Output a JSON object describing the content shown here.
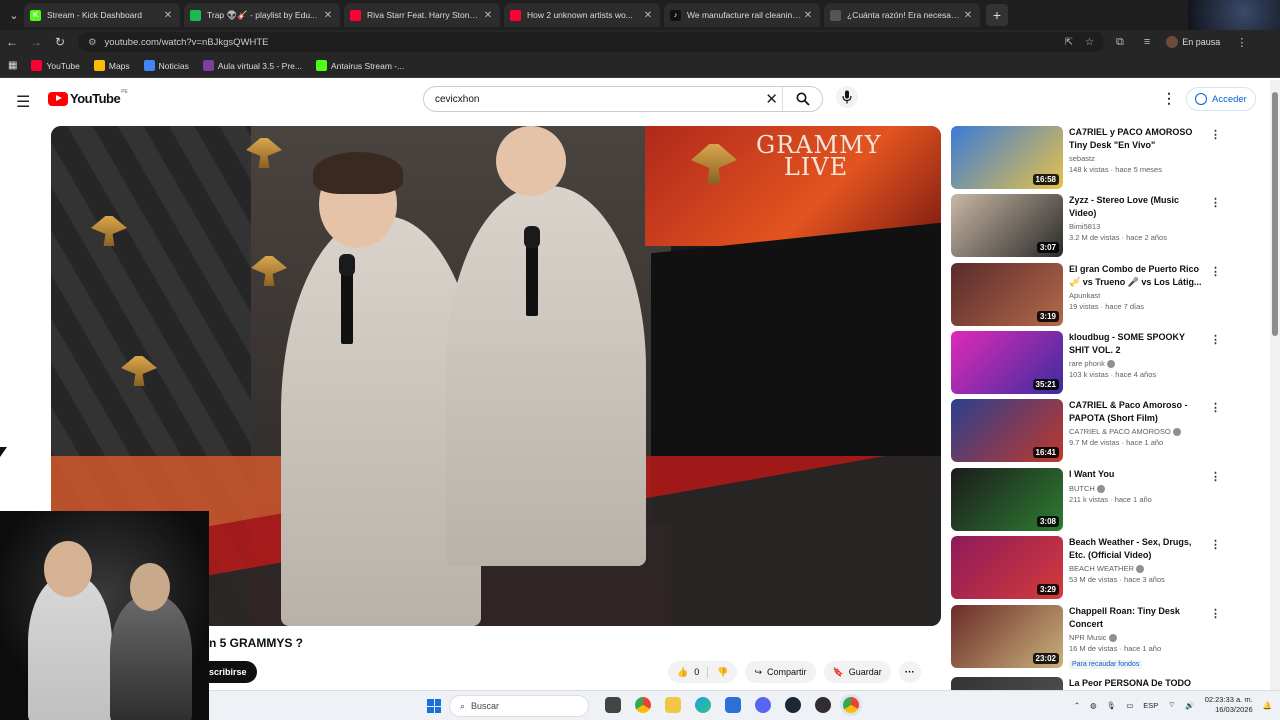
{
  "browser": {
    "tabs": [
      {
        "title": "Stream - Kick Dashboard",
        "color": "#53fc18",
        "glyph": "K"
      },
      {
        "title": "Trap 👽🎸 - playlist by Edu...",
        "color": "#1db954",
        "glyph": ""
      },
      {
        "title": "Riva Starr Feat. Harry Stone - I...",
        "color": "#ff0033",
        "glyph": ""
      },
      {
        "title": "How 2 unknown artists wo...",
        "color": "#ff0033",
        "glyph": ""
      },
      {
        "title": "We manufacture rail cleaning...",
        "color": "#111111",
        "glyph": "♪"
      },
      {
        "title": "¿Cuánta razón! Era necesario p...",
        "color": "#555555",
        "glyph": ""
      }
    ],
    "url": "youtube.com/watch?v=nBJkgsQWHTE",
    "profile_status": "En pausa",
    "bookmarks": [
      {
        "label": "YouTube",
        "color": "#ff0033"
      },
      {
        "label": "Maps",
        "color": "#fbbc04"
      },
      {
        "label": "Noticias",
        "color": "#4285f4"
      },
      {
        "label": "Aula virtual 3.5 - Pre...",
        "color": "#7b3fa0"
      },
      {
        "label": "Antairus Stream -...",
        "color": "#53fc18"
      }
    ]
  },
  "youtube": {
    "logo_text": "YouTube",
    "logo_country": "PE",
    "search_value": "cevicxhon",
    "signin_label": "Acceder",
    "video": {
      "overlay_text": "GRAMMY LIVE",
      "title_partial": "n 5 GRAMMYS ?",
      "subscribe_label": "scribirse",
      "like_count": "0",
      "share_label": "Compartir",
      "save_label": "Guardar"
    },
    "recommendations": [
      {
        "title": "CA7RIEL y PACO AMOROSO Tiny Desk \"En Vivo\"",
        "channel": "sebastz",
        "verified": false,
        "meta": "148 k vistas · hace 5 meses",
        "duration": "16:58",
        "thumb": [
          "#3a7bd5",
          "#e8c14a"
        ],
        "badge": ""
      },
      {
        "title": "Zyzz - Stereo Love (Music Video)",
        "channel": "Bimi5813",
        "verified": false,
        "meta": "3.2 M de vistas · hace 2 años",
        "duration": "3:07",
        "thumb": [
          "#c9b8a4",
          "#2a2a2a"
        ],
        "badge": ""
      },
      {
        "title": "El gran Combo de Puerto Rico 🎺 vs Trueno 🎤 vs Los Látig...",
        "channel": "Apunkast",
        "verified": false,
        "meta": "19 vistas · hace 7 días",
        "duration": "3:19",
        "thumb": [
          "#5a2a2a",
          "#b46a4a"
        ],
        "badge": ""
      },
      {
        "title": "kloudbug - SOME SPOOKY SHIT VOL. 2",
        "channel": "rare phonk",
        "verified": true,
        "meta": "103 k vistas · hace 4 años",
        "duration": "35:21",
        "thumb": [
          "#e02ab8",
          "#3a2d9e"
        ],
        "badge": ""
      },
      {
        "title": "CA7RIEL & Paco Amoroso - PAPOTA (Short Film)",
        "channel": "CA7RIEL & PACO AMOROSO",
        "verified": true,
        "meta": "9.7 M de vistas · hace 1 año",
        "duration": "16:41",
        "thumb": [
          "#2b3f8f",
          "#c0392b"
        ],
        "badge": ""
      },
      {
        "title": "I Want You",
        "channel": "BUTCH",
        "verified": true,
        "meta": "211 k vistas · hace 1 año",
        "duration": "3:08",
        "thumb": [
          "#1b1b1b",
          "#2e7d32"
        ],
        "badge": ""
      },
      {
        "title": "Beach Weather - Sex, Drugs, Etc. (Official Video)",
        "channel": "BEACH WEATHER",
        "verified": true,
        "meta": "53 M de vistas · hace 3 años",
        "duration": "3:29",
        "thumb": [
          "#8e1a5a",
          "#d43b3b"
        ],
        "badge": ""
      },
      {
        "title": "Chappell Roan: Tiny Desk Concert",
        "channel": "NPR Music",
        "verified": true,
        "meta": "16 M de vistas · hace 1 año",
        "duration": "23:02",
        "thumb": [
          "#6d2b2b",
          "#c8b27a"
        ],
        "badge": "Para recaudar fondos"
      },
      {
        "title": "La Peor PERSONA De TODO",
        "channel": "",
        "verified": false,
        "meta": "",
        "duration": "",
        "thumb": [
          "#333333",
          "#555555"
        ],
        "badge": ""
      }
    ]
  },
  "taskbar": {
    "search_placeholder": "Buscar",
    "language": "ESP",
    "time": "02:23:33 a. m.",
    "date": "16/03/2026"
  }
}
